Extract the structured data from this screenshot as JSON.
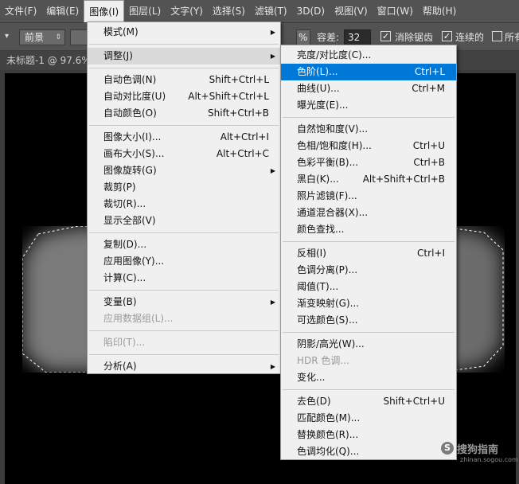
{
  "menubar": {
    "items": [
      "文件(F)",
      "编辑(E)",
      "图像(I)",
      "图层(L)",
      "文字(Y)",
      "选择(S)",
      "滤镜(T)",
      "3D(D)",
      "视图(V)",
      "窗口(W)",
      "帮助(H)"
    ]
  },
  "options": {
    "fill_source": "前景",
    "opacity_unit": "%",
    "tolerance_label": "容差:",
    "tolerance_value": "32",
    "antialias_label": "消除锯齿",
    "contiguous_label": "连续的",
    "all_layers_label": "所有"
  },
  "document": {
    "tab_label": "未标题-1 @ 97.6%"
  },
  "image_menu": {
    "mode": "模式(M)",
    "adjust": "调整(J)",
    "auto_tone": {
      "label": "自动色调(N)",
      "shortcut": "Shift+Ctrl+L"
    },
    "auto_contrast": {
      "label": "自动对比度(U)",
      "shortcut": "Alt+Shift+Ctrl+L"
    },
    "auto_color": {
      "label": "自动颜色(O)",
      "shortcut": "Shift+Ctrl+B"
    },
    "image_size": {
      "label": "图像大小(I)...",
      "shortcut": "Alt+Ctrl+I"
    },
    "canvas_size": {
      "label": "画布大小(S)...",
      "shortcut": "Alt+Ctrl+C"
    },
    "rotation": "图像旋转(G)",
    "crop": "裁剪(P)",
    "trim": "裁切(R)...",
    "reveal_all": "显示全部(V)",
    "duplicate": "复制(D)...",
    "apply_image": "应用图像(Y)...",
    "calculations": "计算(C)...",
    "variables": "变量(B)",
    "apply_data_set": "应用数据组(L)...",
    "trap": "陷印(T)...",
    "analysis": "分析(A)"
  },
  "adjust_menu": {
    "brightness_contrast": "亮度/对比度(C)...",
    "levels": {
      "label": "色阶(L)...",
      "shortcut": "Ctrl+L"
    },
    "curves": {
      "label": "曲线(U)...",
      "shortcut": "Ctrl+M"
    },
    "exposure": "曝光度(E)...",
    "vibrance": "自然饱和度(V)...",
    "hue_saturation": {
      "label": "色相/饱和度(H)...",
      "shortcut": "Ctrl+U"
    },
    "color_balance": {
      "label": "色彩平衡(B)...",
      "shortcut": "Ctrl+B"
    },
    "black_white": {
      "label": "黑白(K)...",
      "shortcut": "Alt+Shift+Ctrl+B"
    },
    "photo_filter": "照片滤镜(F)...",
    "channel_mixer": "通道混合器(X)...",
    "color_lookup": "颜色查找...",
    "invert": {
      "label": "反相(I)",
      "shortcut": "Ctrl+I"
    },
    "posterize": "色调分离(P)...",
    "threshold": "阈值(T)...",
    "gradient_map": "渐变映射(G)...",
    "selective_color": "可选颜色(S)...",
    "shadows_highlights": "阴影/高光(W)...",
    "hdr_toning": "HDR 色调...",
    "variations": "变化...",
    "desaturate": {
      "label": "去色(D)",
      "shortcut": "Shift+Ctrl+U"
    },
    "match_color": "匹配颜色(M)...",
    "replace_color": "替换颜色(R)...",
    "equalize": "色调均化(Q)..."
  },
  "watermark": {
    "title": "搜狗指南",
    "domain": "zhinan.sogou.com"
  },
  "colors": {
    "highlight": "#0078d7",
    "menu_bg": "#f0f0f0",
    "app_bg": "#535353"
  }
}
